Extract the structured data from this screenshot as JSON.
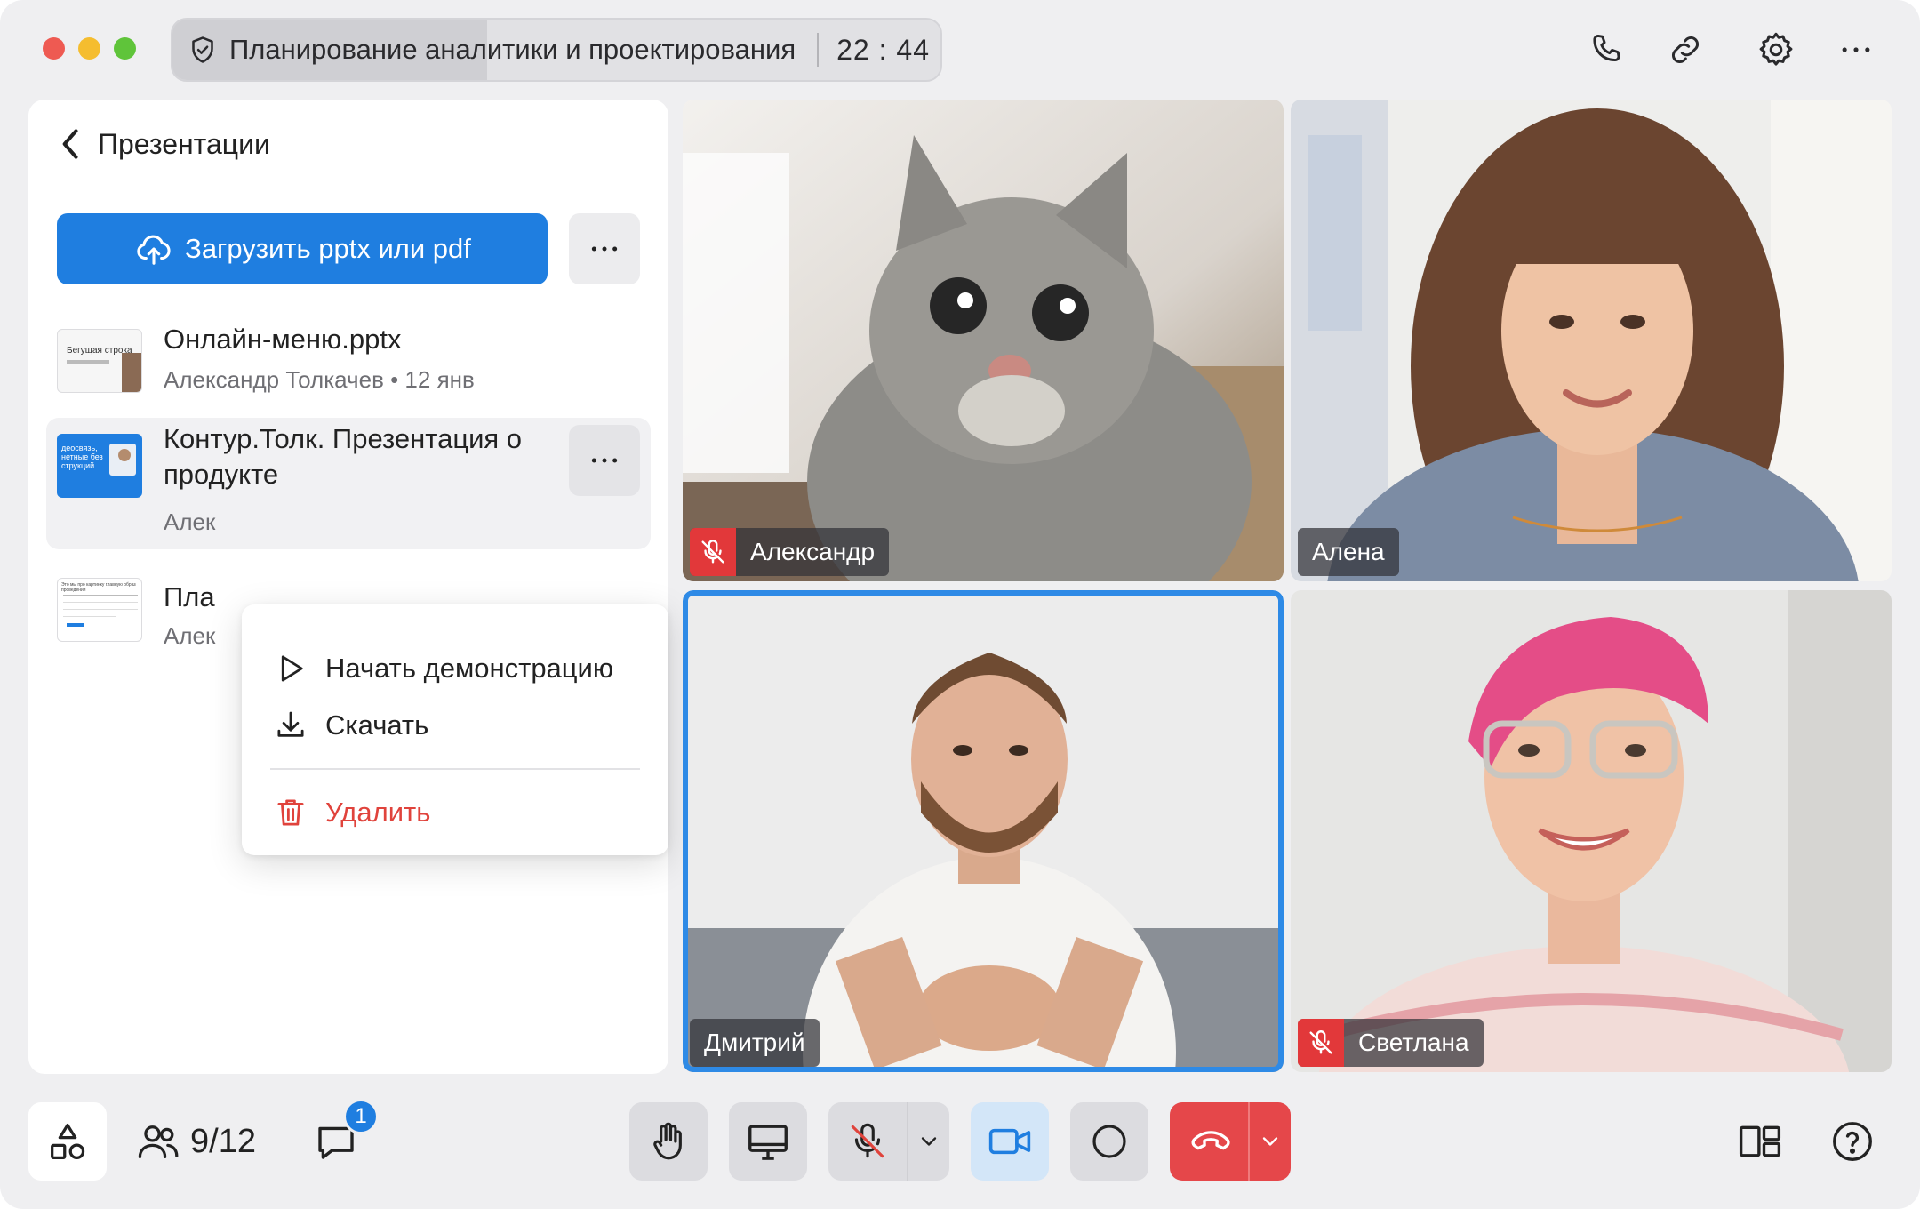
{
  "window": {
    "meeting_title": "Планирование аналитики и проектирования",
    "timer": "22 : 44",
    "meeting_progress": 0.41
  },
  "panel": {
    "title": "Презентации",
    "upload_label": "Загрузить pptx или pdf",
    "files": [
      {
        "name": "Онлайн-меню.pptx",
        "meta": "Александр Толкачев • 12 янв",
        "thumb_caption": "Бегущая строка"
      },
      {
        "name_line1": "Контур.Толк. Презентация о",
        "name_line2": "продукте",
        "meta": "Алек",
        "thumb_caption": "деосвязь, нетные без струкций"
      },
      {
        "name": "Пла",
        "meta": "Алек",
        "thumb_caption": "Это мы про картинку главную образ проведения"
      }
    ]
  },
  "context_menu": {
    "start_demo": "Начать демонстрацию",
    "download": "Скачать",
    "delete": "Удалить"
  },
  "participants": [
    {
      "name": "Александр",
      "muted": true
    },
    {
      "name": "Алена",
      "muted": false
    },
    {
      "name": "Дмитрий",
      "muted": false,
      "speaking": true
    },
    {
      "name": "Светлана",
      "muted": true
    }
  ],
  "toolbar": {
    "participants_count": "9/12",
    "chat_badge": "1"
  },
  "colors": {
    "accent": "#1f7ee0",
    "danger": "#e0433c",
    "hangup": "#e5474a",
    "camera_active_bg": "#d3e6f8"
  },
  "icons": [
    "shield-check-icon",
    "phone-icon",
    "link-icon",
    "gear-icon",
    "more-horizontal-icon",
    "chevron-left-icon",
    "cloud-upload-icon",
    "play-icon",
    "download-icon",
    "trash-icon",
    "mic-off-icon",
    "apps-icon",
    "people-icon",
    "chat-icon",
    "raise-hand-icon",
    "screen-share-icon",
    "chevron-down-icon",
    "camera-icon",
    "record-icon",
    "hang-up-icon",
    "layout-icon",
    "help-icon"
  ]
}
